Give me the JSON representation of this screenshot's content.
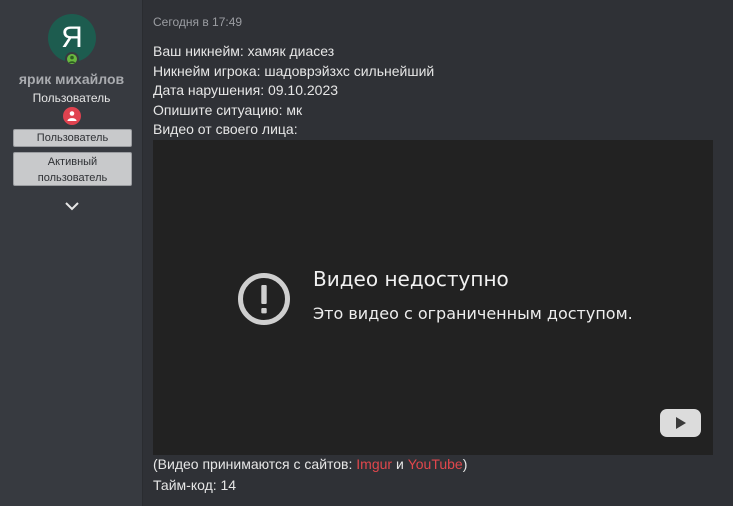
{
  "user": {
    "avatar_letter": "Я",
    "username": "ярик михайлов",
    "title": "Пользователь",
    "banners": [
      "Пользователь",
      "Активный пользователь"
    ]
  },
  "post": {
    "timestamp": "Сегодня в 17:49",
    "lines": [
      "Ваш никнейм: хамяк диасез",
      "Никнейм игрока: шадоврэйзхс сильнейший",
      "Дата нарушения: 09.10.2023",
      "Опишите ситуацию: мк",
      "Видео от своего лица:"
    ],
    "video": {
      "title": "Видео недоступно",
      "subtitle": "Это видео с ограниченным доступом."
    },
    "note": {
      "prefix": "(Видео принимаются с сайтов: ",
      "link1": "Imgur",
      "conj": " и ",
      "link2": "YouTube",
      "suffix": ")"
    },
    "timecode": "Тайм-код: 14"
  },
  "colors": {
    "avatar_bg": "#1d5c4f",
    "link": "#e0474c",
    "online": "#69b83f",
    "role_icon": "#e0424f"
  }
}
